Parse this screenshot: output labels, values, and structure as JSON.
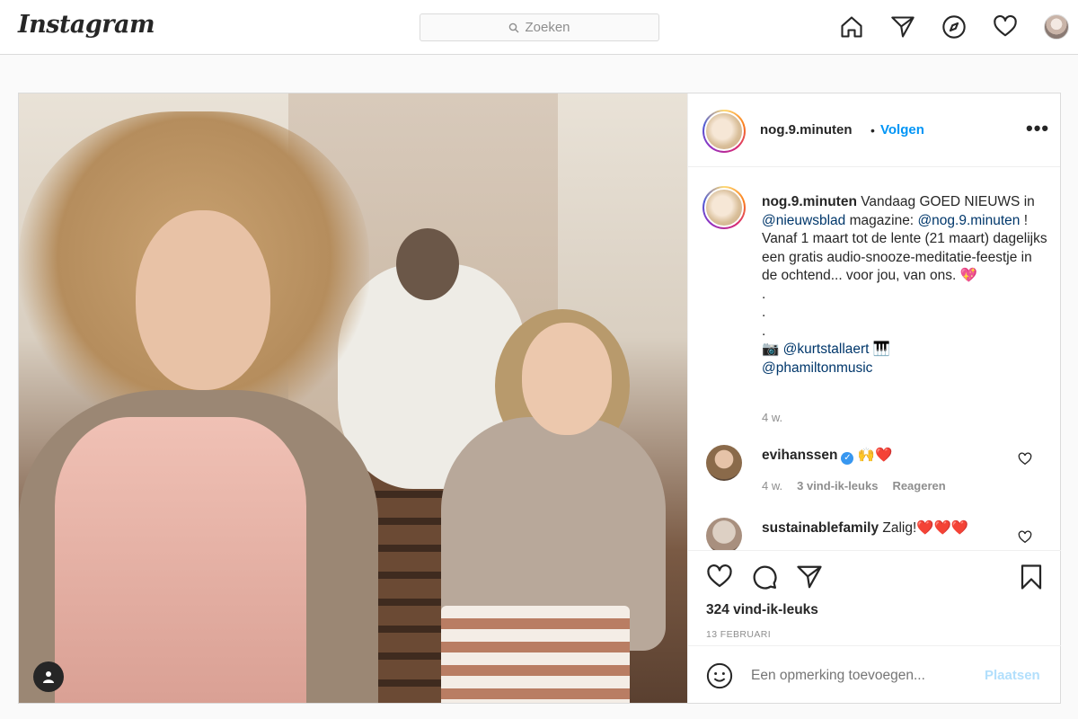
{
  "header": {
    "logo": "Instagram",
    "search_placeholder": "Zoeken",
    "nav_icons": [
      "home-icon",
      "direct-icon",
      "explore-icon",
      "activity-heart-icon",
      "profile-avatar"
    ]
  },
  "post": {
    "author": "nog.9.minuten",
    "follow_sep": "•",
    "follow_label": "Volgen",
    "more_label": "•••",
    "caption": {
      "username": "nog.9.minuten",
      "text_1": " Vandaag GOED NIEUWS in ",
      "mention_1": "@nieuwsblad",
      "text_2": " magazine: ",
      "mention_2": "@nog.9.minuten",
      "text_3": " ! Vanaf 1 maart tot de lente (21 maart) dagelijks een gratis audio-snooze-meditatie-feestje in de ochtend... voor jou, van ons. ",
      "emoji_1": "💖",
      "dots": [
        ".",
        ".",
        "."
      ],
      "camera": "📷",
      "mention_3": "@kurtstallaert",
      "piano": "🎹",
      "mention_4": "@phamiltonmusic",
      "time": "4 w."
    },
    "comments": [
      {
        "username": "evihanssen",
        "verified": true,
        "text": "🙌❤️",
        "time": "4 w.",
        "likes": "3 vind-ik-leuks",
        "reply": "Reageren"
      },
      {
        "username": "sustainablefamily",
        "text": "Zalig!❤️❤️❤️"
      }
    ],
    "likes": "324 vind-ik-leuks",
    "date": "13 FEBRUARI",
    "add_comment_placeholder": "Een opmerking toevoegen...",
    "post_button": "Plaatsen"
  },
  "colors": {
    "link_blue": "#0095f6",
    "mention_dark_blue": "#00376b",
    "muted": "#8e8e8e",
    "border": "#dbdbdb"
  }
}
